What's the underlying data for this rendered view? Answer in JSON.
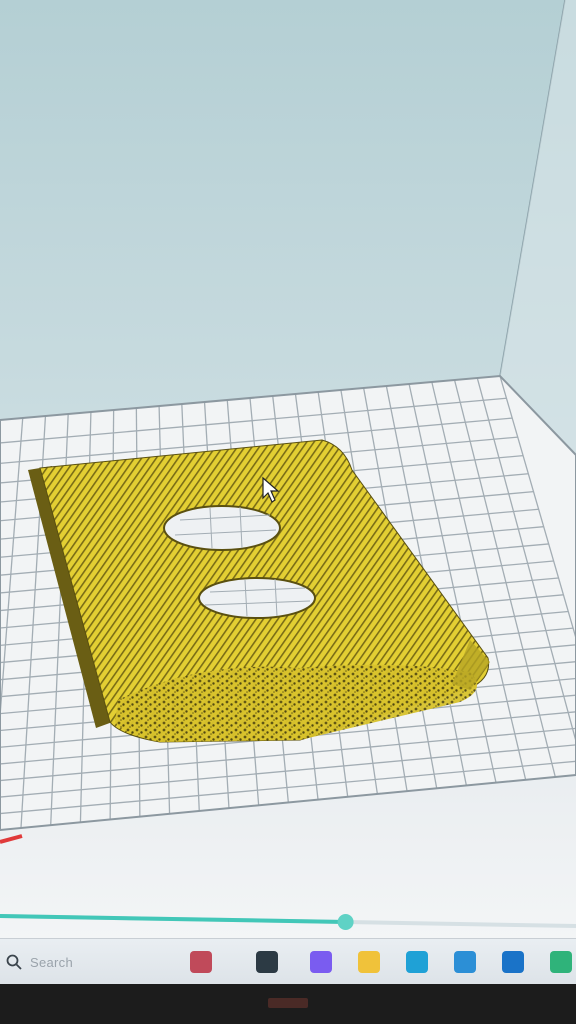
{
  "viewport": {
    "description_hidden": false,
    "colors": {
      "sky_top": "#b7d3d8",
      "sky_bottom": "#dfeaee",
      "floor": "#eef1f3",
      "grid_line": "#9fa9b0",
      "grid_border": "#8c98a0",
      "model_fill": "#e6d23a",
      "model_dark": "#6e6318",
      "model_shadow": "#3f3a10",
      "progress_track": "#42c7b8",
      "progress_handle": "#5fd2c5",
      "red_marker": "#e03a3a"
    }
  },
  "slider": {
    "progress": 0.6
  },
  "taskbar": {
    "search_label": "Search",
    "icons": [
      {
        "name": "widgets-icon",
        "color": "#c04a5a"
      },
      {
        "name": "task-view-icon",
        "color": "#2c3a44"
      },
      {
        "name": "copilot-icon",
        "color": "#7a5cf0"
      },
      {
        "name": "file-explorer-icon",
        "color": "#f0c23a"
      },
      {
        "name": "edge-icon",
        "color": "#1fa1d6"
      },
      {
        "name": "store-icon",
        "color": "#2c8fd6"
      },
      {
        "name": "outlook-icon",
        "color": "#1a73c8"
      },
      {
        "name": "app-icon",
        "color": "#2fb37a"
      }
    ]
  }
}
